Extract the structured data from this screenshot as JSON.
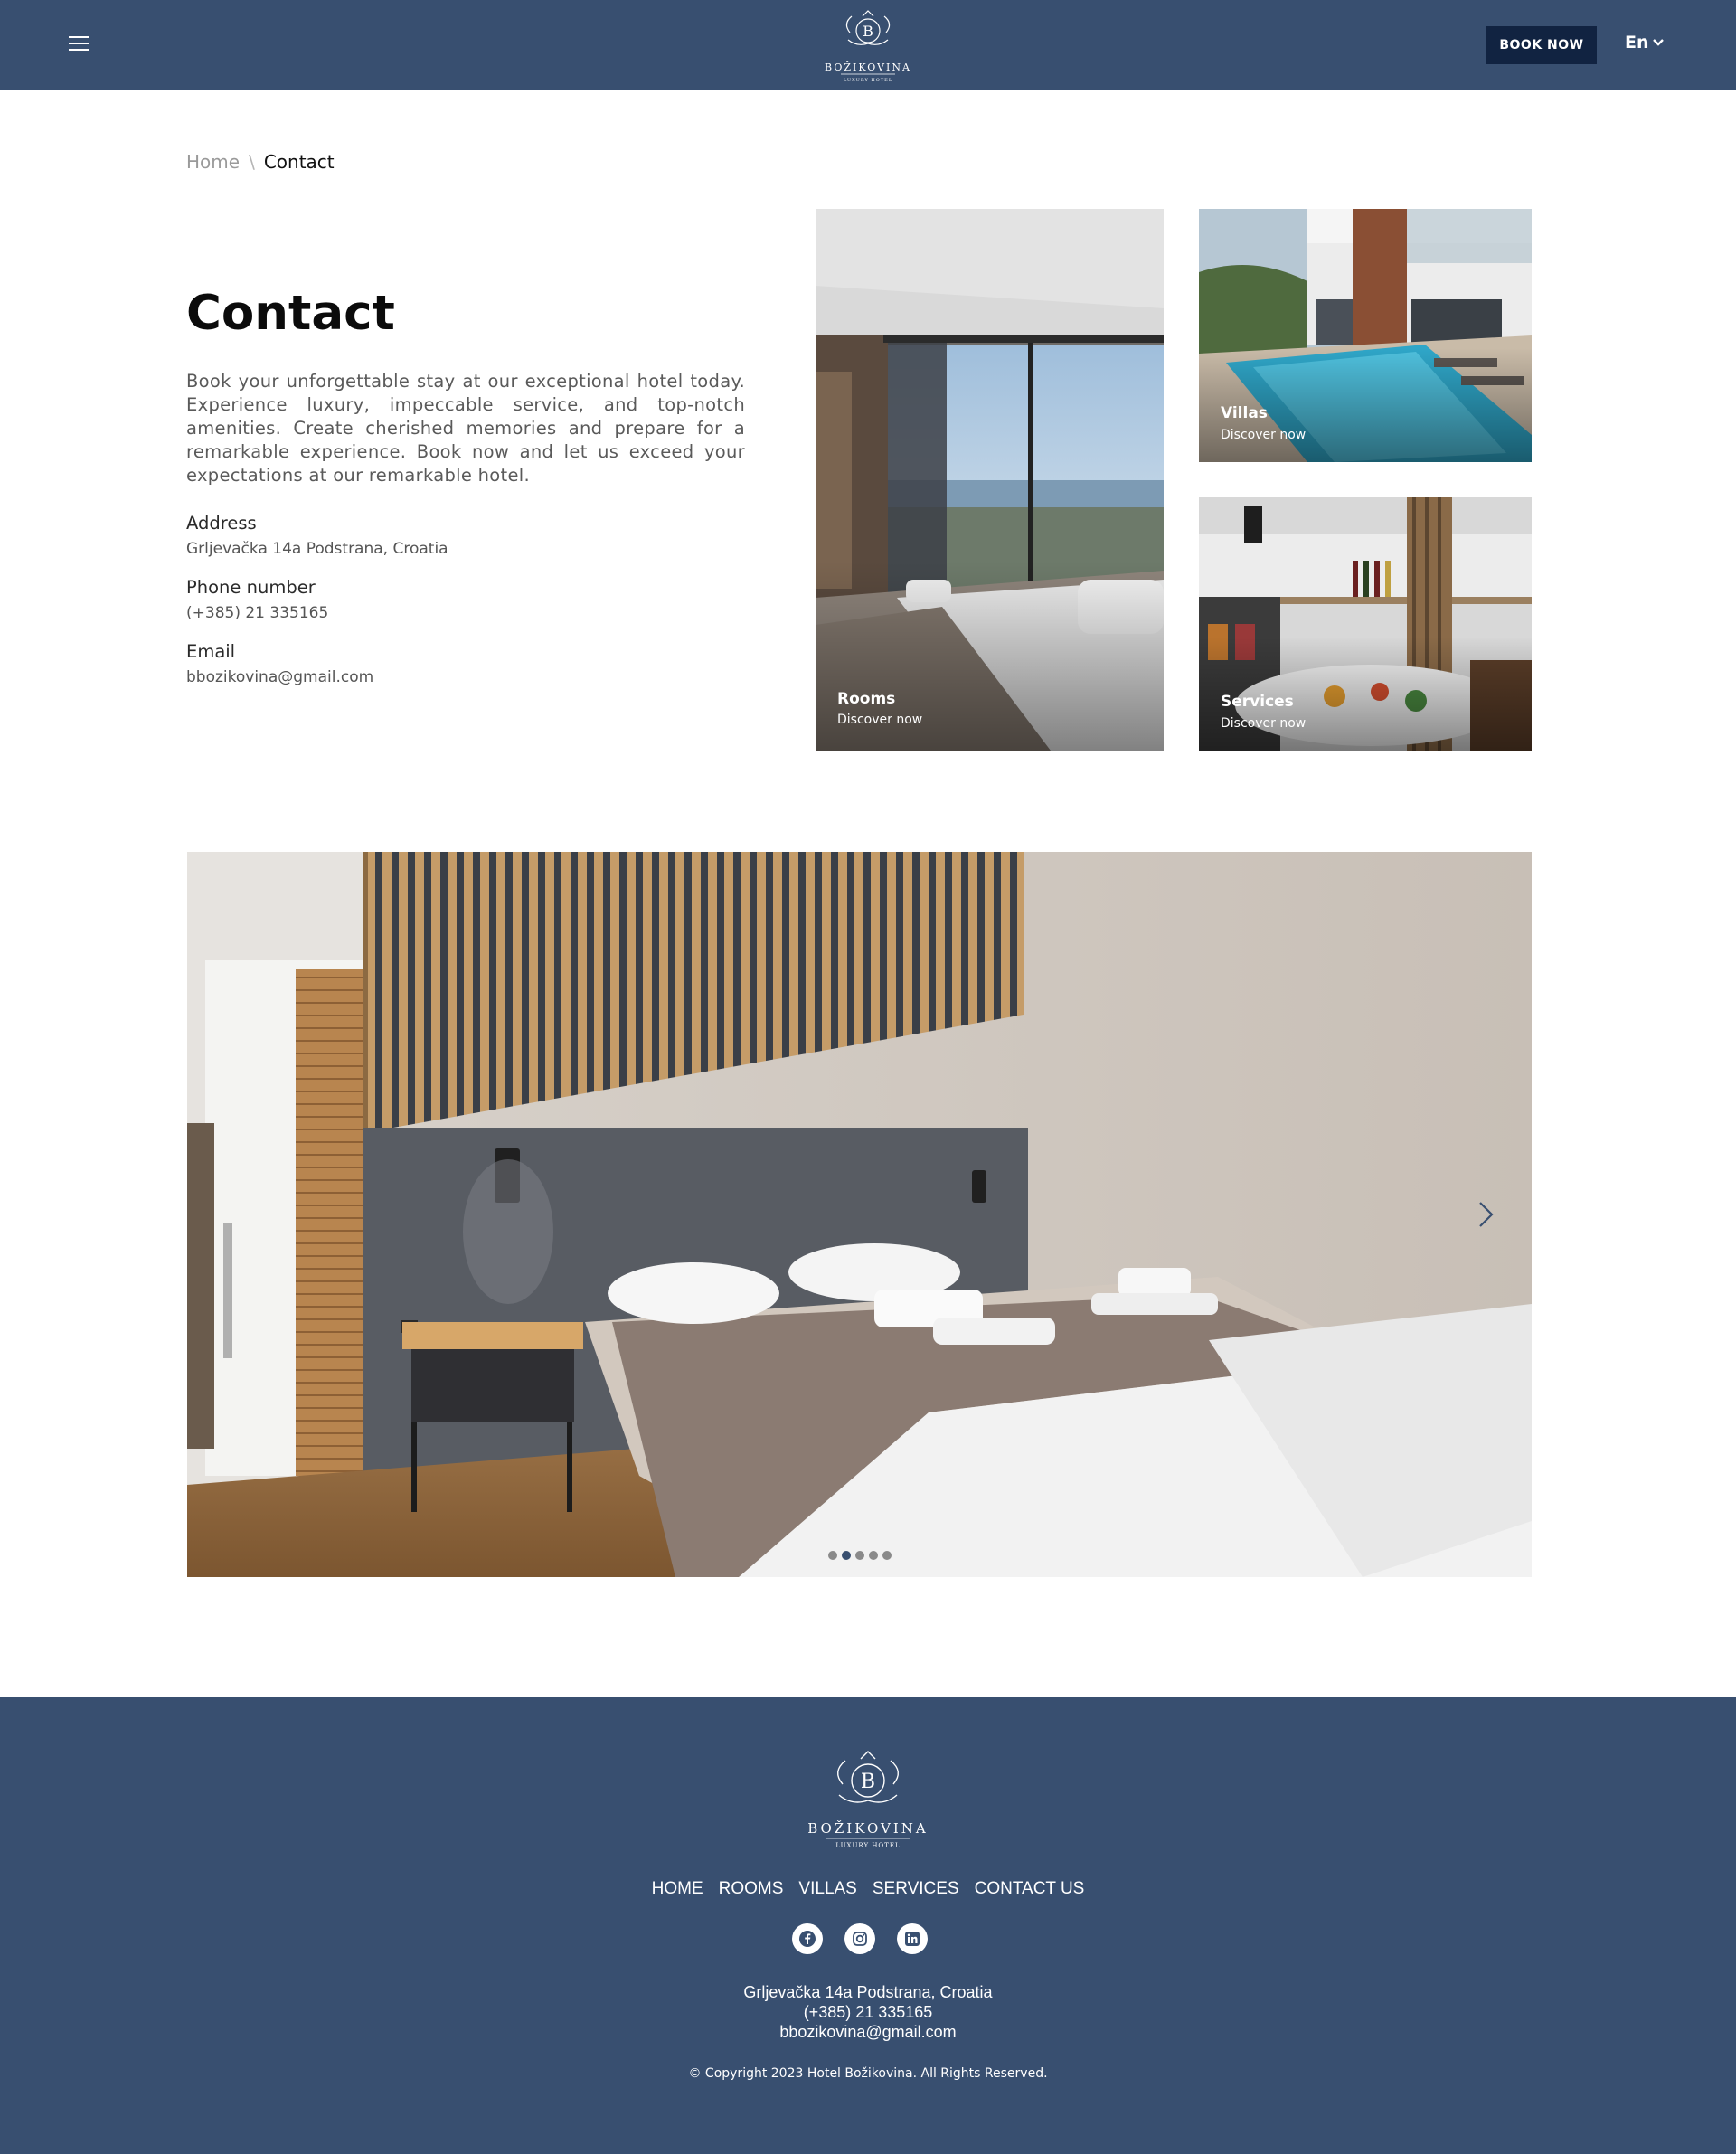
{
  "header": {
    "brand": "BOŽIKOVINA",
    "brand_sub": "LUXURY HOTEL",
    "book_label": "BOOK NOW",
    "language": "En"
  },
  "breadcrumb": {
    "home": "Home",
    "separator": "\\",
    "current": "Contact"
  },
  "contact": {
    "title": "Contact",
    "intro": "Book your unforgettable stay at our exceptional hotel today. Experience luxury, impeccable service, and top-notch amenities. Create cherished memories and prepare for a remarkable experience. Book now and let us exceed your expectations at our remarkable hotel.",
    "address_label": "Address",
    "address": "Grljevačka 14a Podstrana, Croatia",
    "phone_label": "Phone number",
    "phone": "(+385) 21 335165",
    "email_label": "Email",
    "email": "bbozikovina@gmail.com"
  },
  "cards": {
    "rooms": {
      "title": "Rooms",
      "sub": "Discover now"
    },
    "villas": {
      "title": "Villas",
      "sub": "Discover now"
    },
    "services": {
      "title": "Services",
      "sub": "Discover now"
    }
  },
  "slider": {
    "slide_count": 5,
    "active_slide": 2
  },
  "footer": {
    "brand": "BOŽIKOVINA",
    "brand_sub": "LUXURY HOTEL",
    "nav": [
      "HOME",
      "ROOMS",
      "VILLAS",
      "SERVICES",
      "CONTACT US"
    ],
    "address": "Grljevačka 14a Podstrana, Croatia",
    "phone": "(+385) 21 335165",
    "email": "bbozikovina@gmail.com",
    "copyright": "© Copyright 2023 Hotel Božikovina. All Rights Reserved."
  },
  "colors": {
    "brand_blue": "#384f70",
    "dark_navy": "#112341"
  },
  "icons": [
    "menu-icon",
    "chevron-down-icon",
    "chevron-right-icon",
    "facebook-icon",
    "instagram-icon",
    "linkedin-icon"
  ]
}
